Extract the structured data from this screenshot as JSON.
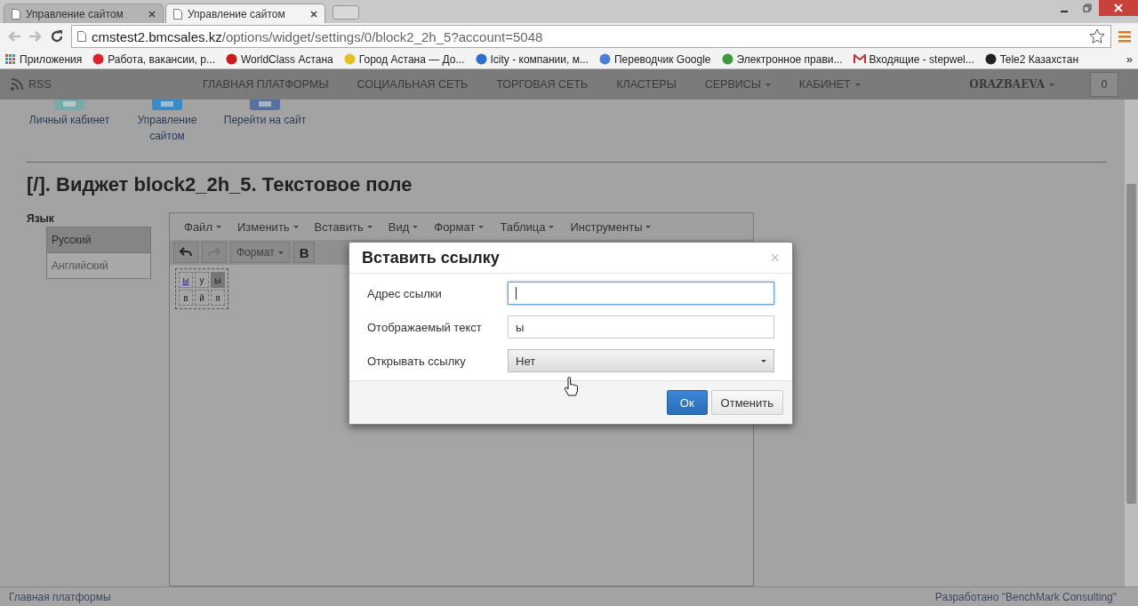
{
  "browser": {
    "tabs": [
      {
        "title": "Управление сайтом",
        "selected": false
      },
      {
        "title": "Управление сайтом",
        "selected": true
      }
    ],
    "address": {
      "host": "cmstest2.bmcsales.kz",
      "path": "/options/widget/settings/0/block2_2h_5?account=5048"
    },
    "bookmarks": [
      {
        "label": "Приложения",
        "kind": "apps"
      },
      {
        "label": "Работа, вакансии, р...",
        "kind": "site",
        "color": "#e0202a"
      },
      {
        "label": "WorldClass Астана",
        "kind": "site",
        "color": "#d01818"
      },
      {
        "label": "Город Астана — До...",
        "kind": "site",
        "color": "#e8c020"
      },
      {
        "label": "Icity - компании, м...",
        "kind": "site",
        "color": "#2a70d0"
      },
      {
        "label": "Переводчик Google",
        "kind": "site",
        "color": "#4a80d8"
      },
      {
        "label": "Электронное прави...",
        "kind": "site",
        "color": "#3a9a3a"
      },
      {
        "label": "Входящие - stepwel...",
        "kind": "mail",
        "color": "#c83030"
      },
      {
        "label": "Tele2 Казахстан",
        "kind": "site",
        "color": "#202020"
      }
    ],
    "more": "»"
  },
  "nav": {
    "rss": "RSS",
    "items": [
      {
        "label": "ГЛАВНАЯ ПЛАТФОРМЫ",
        "dropdown": false
      },
      {
        "label": "СОЦИАЛЬНАЯ СЕТЬ",
        "dropdown": false
      },
      {
        "label": "ТОРГОВАЯ СЕТЬ",
        "dropdown": false
      },
      {
        "label": "КЛАСТЕРЫ",
        "dropdown": false
      },
      {
        "label": "СЕРВИСЫ",
        "dropdown": true
      },
      {
        "label": "КАБИНЕТ",
        "dropdown": true
      }
    ],
    "user": "ORAZBAEVA",
    "counter": "0"
  },
  "shortcuts": [
    {
      "label": "Личный кабинет",
      "kind": "cabinet"
    },
    {
      "label": "Управление сайтом",
      "kind": "manage"
    },
    {
      "label": "Перейти на сайт",
      "kind": "site"
    }
  ],
  "page_title": "[/]. Виджет block2_2h_5. Текстовое поле",
  "language": {
    "label": "Язык",
    "items": [
      {
        "label": "Русский",
        "selected": true
      },
      {
        "label": "Английский",
        "selected": false
      }
    ]
  },
  "editor": {
    "menu": [
      "Файл",
      "Изменить",
      "Вставить",
      "Вид",
      "Формат",
      "Таблица",
      "Инструменты"
    ],
    "format": "Формат",
    "bold": "B",
    "cells": [
      {
        "text": "ы",
        "link": true,
        "selected": false
      },
      {
        "text": "у",
        "link": false,
        "selected": false
      },
      {
        "text": "ы",
        "link": false,
        "selected": true
      },
      {
        "text": "в",
        "link": false,
        "selected": false
      },
      {
        "text": "й",
        "link": false,
        "selected": false
      },
      {
        "text": "я",
        "link": false,
        "selected": false
      }
    ]
  },
  "dialog": {
    "title": "Вставить ссылку",
    "close": "×",
    "fields": [
      {
        "label": "Адрес ссылки",
        "kind": "text",
        "focused": true
      },
      {
        "label": "Отображаемый текст",
        "kind": "text",
        "value": "ы",
        "focused": false
      },
      {
        "label": "Открывать ссылку",
        "kind": "select",
        "value": "Нет",
        "focused": false
      }
    ],
    "buttons": [
      {
        "label": "Ок",
        "primary": true
      },
      {
        "label": "Отменить",
        "primary": false
      }
    ]
  },
  "footer": {
    "left": "Главная платформы",
    "right": "Разработано \"BenchMark Consulting\""
  }
}
